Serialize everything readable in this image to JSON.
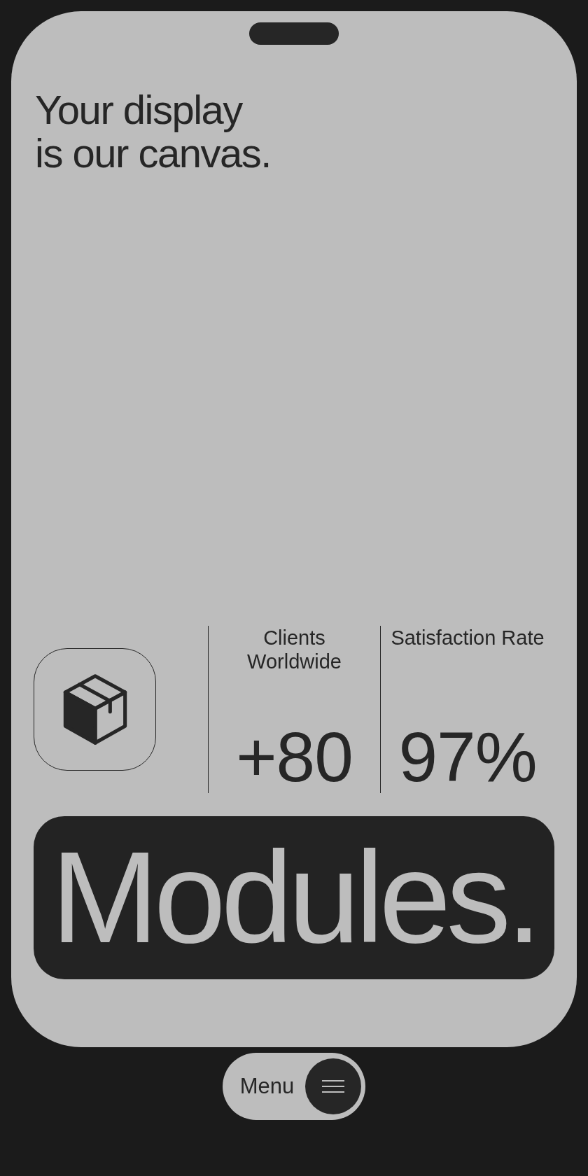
{
  "phone": {
    "headline": [
      "Your display",
      "is our canvas."
    ],
    "stats": [
      {
        "label": [
          "Clients",
          "Worldwide"
        ],
        "value": "+80"
      },
      {
        "label": [
          "Satisfaction Rate"
        ],
        "value": "97%"
      }
    ],
    "banner": {
      "title": "Modules."
    }
  },
  "menu_button": {
    "label": "Menu"
  }
}
